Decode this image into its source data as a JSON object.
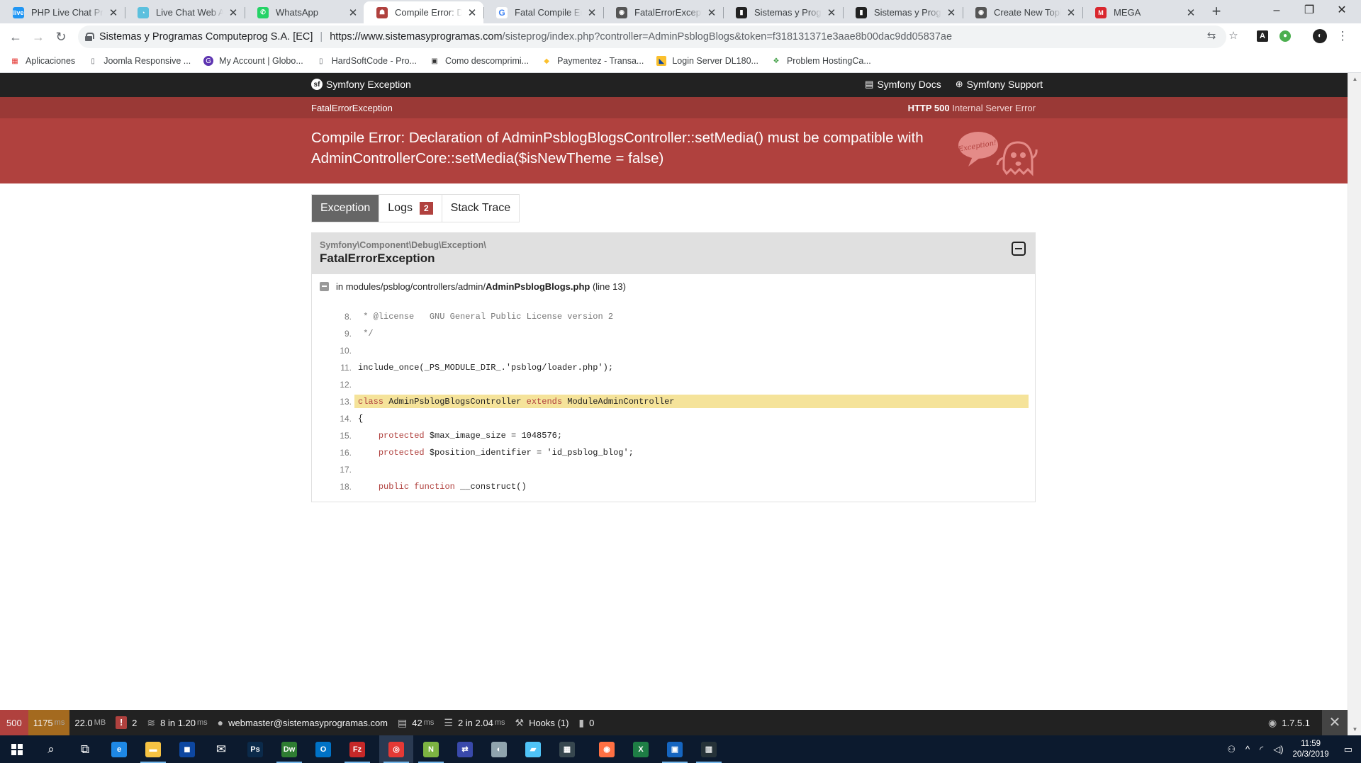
{
  "browser": {
    "tabs": [
      {
        "title": "PHP Live Chat Pro",
        "favicon": "live-chat-pro-favicon",
        "color": "#2196f3",
        "glyph": "live",
        "active": false
      },
      {
        "title": "Live Chat Web App",
        "favicon": "live-chat-web-favicon",
        "color": "#5bc0de",
        "glyph": "◔",
        "active": false
      },
      {
        "title": "WhatsApp",
        "favicon": "whatsapp-favicon",
        "color": "#25d366",
        "glyph": "✆",
        "active": false
      },
      {
        "title": "Compile Error: Decl",
        "favicon": "symfony-ghost-favicon",
        "color": "#b0413e",
        "glyph": "☗",
        "active": true
      },
      {
        "title": "Fatal Compile Error",
        "favicon": "google-favicon",
        "color": "#ffffff",
        "glyph": "G",
        "active": false
      },
      {
        "title": "FatalErrorException",
        "favicon": "prestashop-favicon",
        "color": "#555555",
        "glyph": "◉",
        "active": false
      },
      {
        "title": "Sistemas y Program",
        "favicon": "sistemas-favicon",
        "color": "#222222",
        "glyph": "▮",
        "active": false
      },
      {
        "title": "Sistemas y Program",
        "favicon": "sistemas-favicon",
        "color": "#222222",
        "glyph": "▮",
        "active": false
      },
      {
        "title": "Create New Topic -",
        "favicon": "prestashop-favicon",
        "color": "#555555",
        "glyph": "◉",
        "active": false
      },
      {
        "title": "MEGA",
        "favicon": "mega-favicon",
        "color": "#d9272e",
        "glyph": "M",
        "active": false
      }
    ],
    "site_identity": "Sistemas y Programas Computeprog S.A. [EC]",
    "url_host": "https://www.sistemasyprogramas.com",
    "url_rest": "/sisteprog/index.php?controller=AdminPsblogBlogs&token=f318131371e3aae8b00dac9dd05837ae",
    "bookmarks": [
      {
        "label": "Aplicaciones",
        "icon": "apps-grid-icon"
      },
      {
        "label": "Joomla Responsive ...",
        "icon": "page-icon"
      },
      {
        "label": "My Account | Globo...",
        "icon": "globo-icon"
      },
      {
        "label": "HardSoftCode - Pro...",
        "icon": "page-icon"
      },
      {
        "label": "Como descomprimi...",
        "icon": "archive-icon"
      },
      {
        "label": "Paymentez - Transa...",
        "icon": "paymentez-icon"
      },
      {
        "label": "Login Server DL180...",
        "icon": "hp-icon"
      },
      {
        "label": "Problem HostingCa...",
        "icon": "hostingca-icon"
      }
    ]
  },
  "symfony": {
    "brand": "Symfony Exception",
    "docs_link": "Symfony Docs",
    "support_link": "Symfony Support",
    "exception_short": "FatalErrorException",
    "http_code": "HTTP 500",
    "http_text": "Internal Server Error",
    "message": "Compile Error: Declaration of AdminPsblogBlogsController::setMedia() must be compatible with AdminControllerCore::setMedia($isNewTheme = false)",
    "ghost_label": "Exception!",
    "tabs": {
      "exception": "Exception",
      "logs": "Logs",
      "logs_count": "2",
      "stack": "Stack Trace"
    },
    "trace": {
      "namespace": "Symfony\\Component\\Debug\\Exception\\",
      "class": "FatalErrorException",
      "file_prefix": "in modules/psblog/controllers/admin/",
      "file_name": "AdminPsblogBlogs.php",
      "file_line": "(line 13)"
    },
    "code": [
      {
        "n": "8.",
        "t": " * @license   GNU General Public License version 2"
      },
      {
        "n": "9.",
        "t": " */"
      },
      {
        "n": "10.",
        "t": ""
      },
      {
        "n": "11.",
        "t": "include_once(_PS_MODULE_DIR_.'psblog/loader.php');"
      },
      {
        "n": "12.",
        "t": ""
      },
      {
        "n": "13.",
        "t": "class AdminPsblogBlogsController extends ModuleAdminController",
        "highlight": true
      },
      {
        "n": "14.",
        "t": "{"
      },
      {
        "n": "15.",
        "t": "    protected $max_image_size = 1048576;"
      },
      {
        "n": "16.",
        "t": "    protected $position_identifier = 'id_psblog_blog';"
      },
      {
        "n": "17.",
        "t": ""
      },
      {
        "n": "18.",
        "t": "    public function __construct()"
      }
    ]
  },
  "debug_toolbar": {
    "status": "500",
    "time": "1175",
    "time_unit": "ms",
    "memory": "22.0",
    "memory_unit": "MB",
    "errors": "2",
    "forms": "8 in 1.20",
    "forms_unit": "ms",
    "user": "webmaster@sistemasyprogramas.com",
    "render_time": "42",
    "render_unit": "ms",
    "db": "2 in 2.04",
    "db_unit": "ms",
    "hooks": "Hooks (1)",
    "modules": "0",
    "version": "1.7.5.1"
  },
  "taskbar": {
    "apps": [
      {
        "icon": "search-icon",
        "glyph": "⌕",
        "color": "transparent"
      },
      {
        "icon": "task-view-icon",
        "glyph": "⧉",
        "color": "transparent"
      },
      {
        "icon": "edge-icon",
        "glyph": "e",
        "color": "#1e88e5"
      },
      {
        "icon": "file-explorer-icon",
        "glyph": "▬",
        "color": "#f6c343"
      },
      {
        "icon": "store-icon",
        "glyph": "◼",
        "color": "#0d47a1"
      },
      {
        "icon": "mail-icon",
        "glyph": "✉",
        "color": "transparent"
      },
      {
        "icon": "photoshop-icon",
        "glyph": "Ps",
        "color": "#0b2a4a"
      },
      {
        "icon": "dreamweaver-icon",
        "glyph": "Dw",
        "color": "#2e7d32"
      },
      {
        "icon": "outlook-icon",
        "glyph": "O",
        "color": "#0072c6"
      },
      {
        "icon": "filezilla-icon",
        "glyph": "Fz",
        "color": "#c62828"
      },
      {
        "icon": "chrome-icon",
        "glyph": "◎",
        "color": "#e53935"
      },
      {
        "icon": "notepad-plus-icon",
        "glyph": "N",
        "color": "#7cb342"
      },
      {
        "icon": "network-tool-icon",
        "glyph": "⇄",
        "color": "#3949ab"
      },
      {
        "icon": "tool-icon",
        "glyph": "◐",
        "color": "#90a4ae"
      },
      {
        "icon": "notes-icon",
        "glyph": "▰",
        "color": "#4fc3f7"
      },
      {
        "icon": "calculator-icon",
        "glyph": "▦",
        "color": "#37474f"
      },
      {
        "icon": "firefox-icon",
        "glyph": "◉",
        "color": "#ff7043"
      },
      {
        "icon": "excel-icon",
        "glyph": "X",
        "color": "#1e7e45"
      },
      {
        "icon": "remote-desktop-icon",
        "glyph": "▣",
        "color": "#1565c0"
      },
      {
        "icon": "audio-icon",
        "glyph": "▥",
        "color": "#263238"
      }
    ],
    "time": "11:59",
    "date": "20/3/2019"
  }
}
